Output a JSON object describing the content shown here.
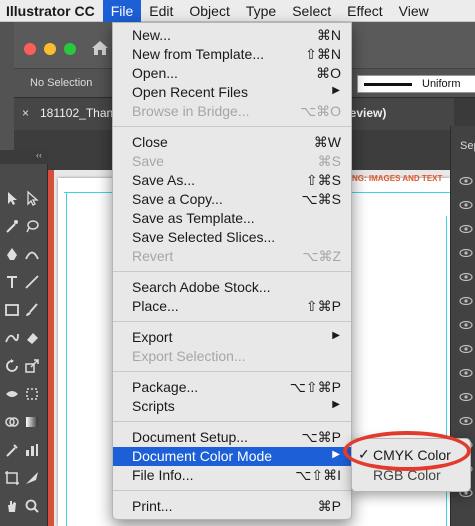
{
  "menubar": {
    "app_name": "Illustrator CC",
    "items": [
      "File",
      "Edit",
      "Object",
      "Type",
      "Select",
      "Effect",
      "View"
    ]
  },
  "control_bar": {
    "selection_status": "No Selection",
    "stroke_style": "Uniform"
  },
  "document_tab": {
    "close_glyph": "×",
    "title": "181102_Than",
    "title_tail": "Preview)"
  },
  "canvas": {
    "artboard_text": "NG: IMAGES AND TEXT"
  },
  "right_panel": {
    "title": "Sep"
  },
  "file_menu": {
    "groups": [
      [
        {
          "label": "New...",
          "shortcut": "⌘N",
          "enabled": true
        },
        {
          "label": "New from Template...",
          "shortcut": "⇧⌘N",
          "enabled": true
        },
        {
          "label": "Open...",
          "shortcut": "⌘O",
          "enabled": true
        },
        {
          "label": "Open Recent Files",
          "submenu": true,
          "enabled": true
        },
        {
          "label": "Browse in Bridge...",
          "shortcut": "⌥⌘O",
          "enabled": false
        }
      ],
      [
        {
          "label": "Close",
          "shortcut": "⌘W",
          "enabled": true
        },
        {
          "label": "Save",
          "shortcut": "⌘S",
          "enabled": false
        },
        {
          "label": "Save As...",
          "shortcut": "⇧⌘S",
          "enabled": true
        },
        {
          "label": "Save a Copy...",
          "shortcut": "⌥⌘S",
          "enabled": true
        },
        {
          "label": "Save as Template...",
          "enabled": true
        },
        {
          "label": "Save Selected Slices...",
          "enabled": true
        },
        {
          "label": "Revert",
          "shortcut": "⌥⌘Z",
          "enabled": false
        }
      ],
      [
        {
          "label": "Search Adobe Stock...",
          "enabled": true
        },
        {
          "label": "Place...",
          "shortcut": "⇧⌘P",
          "enabled": true
        }
      ],
      [
        {
          "label": "Export",
          "submenu": true,
          "enabled": true
        },
        {
          "label": "Export Selection...",
          "enabled": false
        }
      ],
      [
        {
          "label": "Package...",
          "shortcut": "⌥⇧⌘P",
          "enabled": true
        },
        {
          "label": "Scripts",
          "submenu": true,
          "enabled": true
        }
      ],
      [
        {
          "label": "Document Setup...",
          "shortcut": "⌥⌘P",
          "enabled": true
        },
        {
          "label": "Document Color Mode",
          "submenu": true,
          "enabled": true,
          "highlighted": true
        },
        {
          "label": "File Info...",
          "shortcut": "⌥⇧⌘I",
          "enabled": true
        }
      ],
      [
        {
          "label": "Print...",
          "shortcut": "⌘P",
          "enabled": true
        }
      ]
    ]
  },
  "color_mode_submenu": {
    "items": [
      {
        "label": "CMYK Color",
        "checked": true
      },
      {
        "label": "RGB Color",
        "checked": false
      }
    ],
    "check_glyph": "✓"
  },
  "colors": {
    "menu_highlight": "#1c5fd6",
    "annotation": "#e23a2c",
    "guide": "#3fd5e0"
  }
}
